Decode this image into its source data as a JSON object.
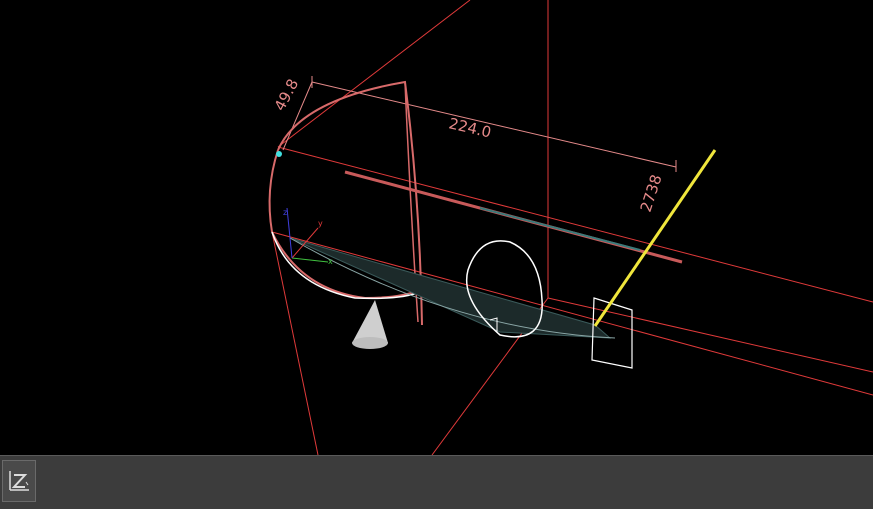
{
  "viewport": {
    "dimensions": {
      "width_label": "224.0",
      "depth_label": "49.8",
      "height_label": "2738"
    },
    "axes": {
      "x_label": "x",
      "y_label": "y",
      "z_label": "z"
    },
    "colors": {
      "background": "#000000",
      "bounding_box": "#e03a3a",
      "dimension": "#e58a8a",
      "curve_white": "#ffffff",
      "highlight": "#f0e63c",
      "selection_point": "#40e0e0"
    }
  },
  "statusbar": {
    "view_button_icon": "axis-view-icon"
  }
}
